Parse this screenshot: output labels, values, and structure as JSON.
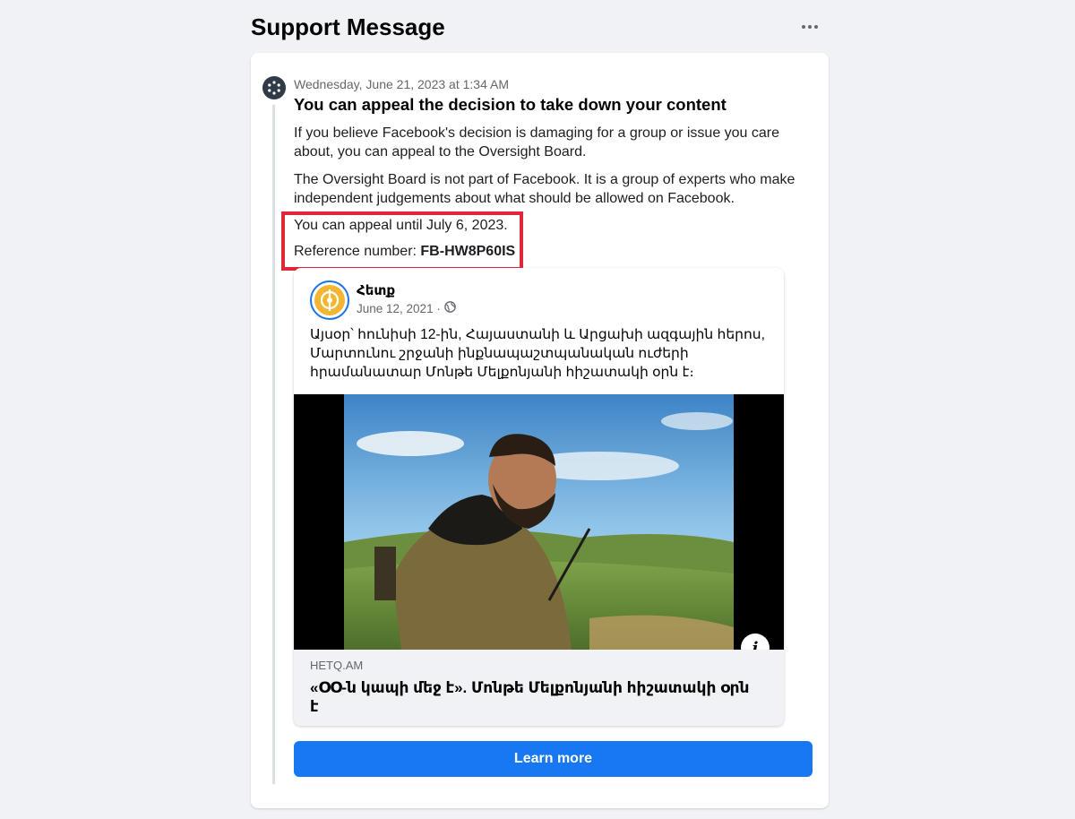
{
  "page": {
    "title": "Support Message",
    "more_label": "More options"
  },
  "message": {
    "timestamp": "Wednesday, June 21, 2023 at 1:34 AM",
    "title": "You can appeal the decision to take down your content",
    "paragraph_1": "If you believe Facebook's decision is damaging for a group or issue you care about, you can appeal to the Oversight Board.",
    "paragraph_2": "The Oversight Board is not part of Facebook. It is a group of experts who make independent judgements about what should be allowed on Facebook.",
    "appeal_deadline": "You can appeal until July 6, 2023.",
    "reference_label": "Reference number: ",
    "reference_number": "FB-HW8P60IS"
  },
  "post": {
    "author": "Հետք",
    "date": "June 12, 2021 · ",
    "privacy_icon": "globe-icon",
    "text": "Այսօր՝ հունիսի 12-ին, Հայաստանի և Արցախի ազգային հերոս, Մարտունու շրջանի ինքնապաշտպանական ուժերի հրամանատար Մոնթե Մելքոնյանի հիշատակի օրն է։",
    "link_domain": "HETQ.AM",
    "link_title": "«ՕՕ-ն կապի մեջ է». Մոնթե Մելքոնյանի հիշատակի օրն է"
  },
  "actions": {
    "learn_more": "Learn more"
  },
  "colors": {
    "accent": "#1877f2",
    "highlight": "#e0273a",
    "background": "#f0f2f5"
  }
}
